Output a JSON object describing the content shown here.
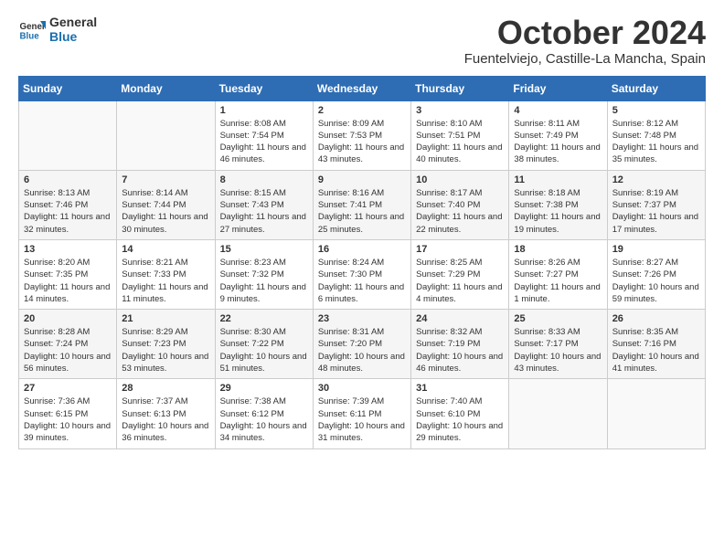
{
  "logo": {
    "line1": "General",
    "line2": "Blue"
  },
  "title": "October 2024",
  "subtitle": "Fuentelviejo, Castille-La Mancha, Spain",
  "headers": [
    "Sunday",
    "Monday",
    "Tuesday",
    "Wednesday",
    "Thursday",
    "Friday",
    "Saturday"
  ],
  "weeks": [
    [
      {
        "day": "",
        "info": ""
      },
      {
        "day": "",
        "info": ""
      },
      {
        "day": "1",
        "info": "Sunrise: 8:08 AM\nSunset: 7:54 PM\nDaylight: 11 hours and 46 minutes."
      },
      {
        "day": "2",
        "info": "Sunrise: 8:09 AM\nSunset: 7:53 PM\nDaylight: 11 hours and 43 minutes."
      },
      {
        "day": "3",
        "info": "Sunrise: 8:10 AM\nSunset: 7:51 PM\nDaylight: 11 hours and 40 minutes."
      },
      {
        "day": "4",
        "info": "Sunrise: 8:11 AM\nSunset: 7:49 PM\nDaylight: 11 hours and 38 minutes."
      },
      {
        "day": "5",
        "info": "Sunrise: 8:12 AM\nSunset: 7:48 PM\nDaylight: 11 hours and 35 minutes."
      }
    ],
    [
      {
        "day": "6",
        "info": "Sunrise: 8:13 AM\nSunset: 7:46 PM\nDaylight: 11 hours and 32 minutes."
      },
      {
        "day": "7",
        "info": "Sunrise: 8:14 AM\nSunset: 7:44 PM\nDaylight: 11 hours and 30 minutes."
      },
      {
        "day": "8",
        "info": "Sunrise: 8:15 AM\nSunset: 7:43 PM\nDaylight: 11 hours and 27 minutes."
      },
      {
        "day": "9",
        "info": "Sunrise: 8:16 AM\nSunset: 7:41 PM\nDaylight: 11 hours and 25 minutes."
      },
      {
        "day": "10",
        "info": "Sunrise: 8:17 AM\nSunset: 7:40 PM\nDaylight: 11 hours and 22 minutes."
      },
      {
        "day": "11",
        "info": "Sunrise: 8:18 AM\nSunset: 7:38 PM\nDaylight: 11 hours and 19 minutes."
      },
      {
        "day": "12",
        "info": "Sunrise: 8:19 AM\nSunset: 7:37 PM\nDaylight: 11 hours and 17 minutes."
      }
    ],
    [
      {
        "day": "13",
        "info": "Sunrise: 8:20 AM\nSunset: 7:35 PM\nDaylight: 11 hours and 14 minutes."
      },
      {
        "day": "14",
        "info": "Sunrise: 8:21 AM\nSunset: 7:33 PM\nDaylight: 11 hours and 11 minutes."
      },
      {
        "day": "15",
        "info": "Sunrise: 8:23 AM\nSunset: 7:32 PM\nDaylight: 11 hours and 9 minutes."
      },
      {
        "day": "16",
        "info": "Sunrise: 8:24 AM\nSunset: 7:30 PM\nDaylight: 11 hours and 6 minutes."
      },
      {
        "day": "17",
        "info": "Sunrise: 8:25 AM\nSunset: 7:29 PM\nDaylight: 11 hours and 4 minutes."
      },
      {
        "day": "18",
        "info": "Sunrise: 8:26 AM\nSunset: 7:27 PM\nDaylight: 11 hours and 1 minute."
      },
      {
        "day": "19",
        "info": "Sunrise: 8:27 AM\nSunset: 7:26 PM\nDaylight: 10 hours and 59 minutes."
      }
    ],
    [
      {
        "day": "20",
        "info": "Sunrise: 8:28 AM\nSunset: 7:24 PM\nDaylight: 10 hours and 56 minutes."
      },
      {
        "day": "21",
        "info": "Sunrise: 8:29 AM\nSunset: 7:23 PM\nDaylight: 10 hours and 53 minutes."
      },
      {
        "day": "22",
        "info": "Sunrise: 8:30 AM\nSunset: 7:22 PM\nDaylight: 10 hours and 51 minutes."
      },
      {
        "day": "23",
        "info": "Sunrise: 8:31 AM\nSunset: 7:20 PM\nDaylight: 10 hours and 48 minutes."
      },
      {
        "day": "24",
        "info": "Sunrise: 8:32 AM\nSunset: 7:19 PM\nDaylight: 10 hours and 46 minutes."
      },
      {
        "day": "25",
        "info": "Sunrise: 8:33 AM\nSunset: 7:17 PM\nDaylight: 10 hours and 43 minutes."
      },
      {
        "day": "26",
        "info": "Sunrise: 8:35 AM\nSunset: 7:16 PM\nDaylight: 10 hours and 41 minutes."
      }
    ],
    [
      {
        "day": "27",
        "info": "Sunrise: 7:36 AM\nSunset: 6:15 PM\nDaylight: 10 hours and 39 minutes."
      },
      {
        "day": "28",
        "info": "Sunrise: 7:37 AM\nSunset: 6:13 PM\nDaylight: 10 hours and 36 minutes."
      },
      {
        "day": "29",
        "info": "Sunrise: 7:38 AM\nSunset: 6:12 PM\nDaylight: 10 hours and 34 minutes."
      },
      {
        "day": "30",
        "info": "Sunrise: 7:39 AM\nSunset: 6:11 PM\nDaylight: 10 hours and 31 minutes."
      },
      {
        "day": "31",
        "info": "Sunrise: 7:40 AM\nSunset: 6:10 PM\nDaylight: 10 hours and 29 minutes."
      },
      {
        "day": "",
        "info": ""
      },
      {
        "day": "",
        "info": ""
      }
    ]
  ]
}
